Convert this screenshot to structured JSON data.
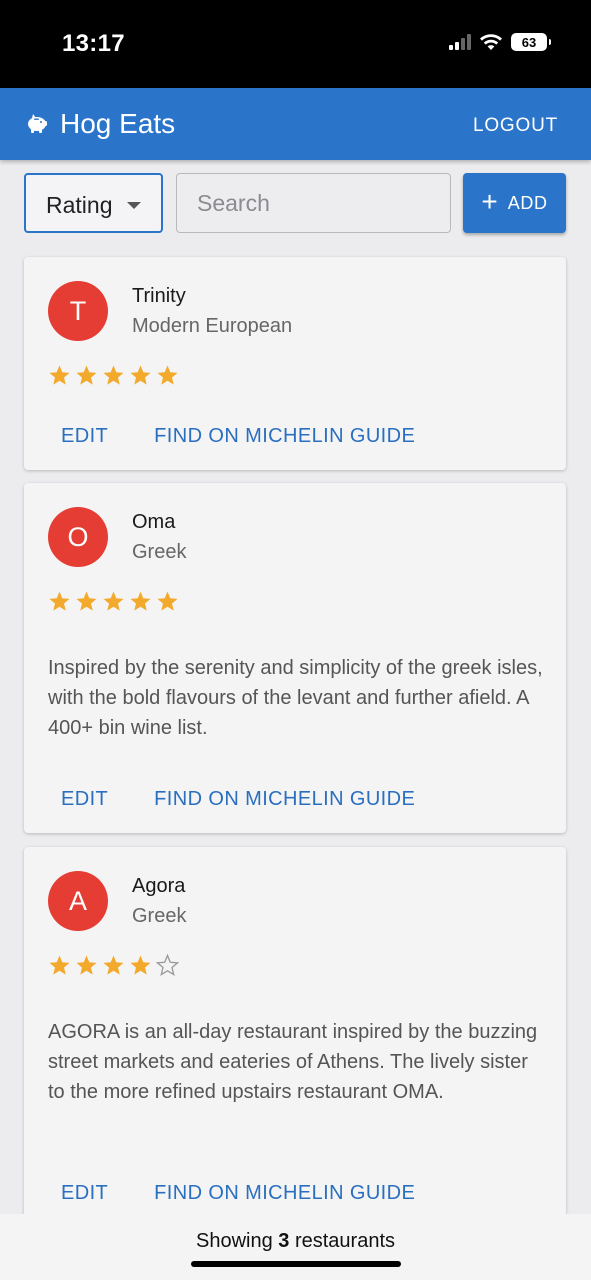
{
  "status_bar": {
    "time": "13:17",
    "battery": "63"
  },
  "app_bar": {
    "title": "Hog Eats",
    "logout_label": "LOGOUT",
    "accent": "#2a74c9"
  },
  "toolbar": {
    "sort_value": "Rating",
    "search_placeholder": "Search",
    "search_value": "",
    "add_label": "ADD"
  },
  "restaurants": [
    {
      "initial": "T",
      "name": "Trinity",
      "cuisine": "Modern European",
      "rating": 5,
      "description": "",
      "edit_label": "EDIT",
      "michelin_label": "FIND ON MICHELIN GUIDE"
    },
    {
      "initial": "O",
      "name": "Oma",
      "cuisine": "Greek",
      "rating": 5,
      "description": "Inspired by the serenity and simplicity of the greek isles, with the bold flavours of the levant and further afield. A 400+ bin wine list.",
      "edit_label": "EDIT",
      "michelin_label": "FIND ON MICHELIN GUIDE"
    },
    {
      "initial": "A",
      "name": "Agora",
      "cuisine": "Greek",
      "rating": 4,
      "description": "AGORA is an all-day restaurant inspired by the buzzing street markets and eateries of Athens. The lively sister to the more refined upstairs restaurant OMA.",
      "edit_label": "EDIT",
      "michelin_label": "FIND ON MICHELIN GUIDE"
    }
  ],
  "rating_max": 5,
  "footer": {
    "prefix": "Showing ",
    "count": "3",
    "suffix": " restaurants"
  },
  "colors": {
    "star_filled": "#f2a92c",
    "star_empty": "#9a9a9a",
    "avatar": "#e53d33"
  }
}
